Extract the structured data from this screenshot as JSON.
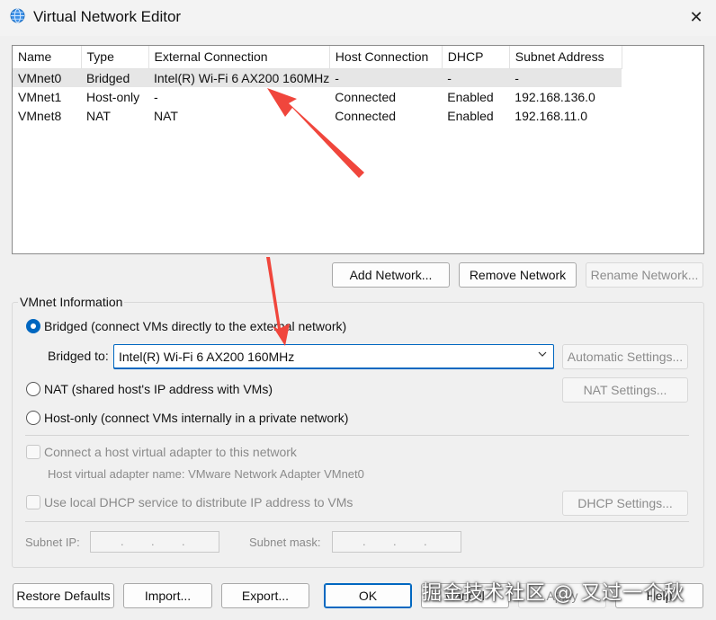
{
  "window": {
    "title": "Virtual Network Editor",
    "close_glyph": "✕",
    "icon": "globe-network-icon"
  },
  "network_table": {
    "columns": [
      "Name",
      "Type",
      "External Connection",
      "Host Connection",
      "DHCP",
      "Subnet Address"
    ],
    "rows": [
      [
        "VMnet0",
        "Bridged",
        "Intel(R) Wi-Fi 6 AX200 160MHz",
        "-",
        "-",
        "-"
      ],
      [
        "VMnet1",
        "Host-only",
        "-",
        "Connected",
        "Enabled",
        "192.168.136.0"
      ],
      [
        "VMnet8",
        "NAT",
        "NAT",
        "Connected",
        "Enabled",
        "192.168.11.0"
      ]
    ],
    "selected_row": 0
  },
  "table_buttons": {
    "add": "Add Network...",
    "remove": "Remove Network",
    "rename": "Rename Network..."
  },
  "vmnet_info": {
    "group_title": "VMnet Information",
    "bridged_label": "Bridged (connect VMs directly to the external network)",
    "bridged_to_label": "Bridged to:",
    "bridged_to_value": "Intel(R) Wi-Fi 6 AX200 160MHz",
    "automatic_settings": "Automatic Settings...",
    "nat_label": "NAT (shared host's IP address with VMs)",
    "nat_settings": "NAT Settings...",
    "hostonly_label": "Host-only (connect VMs internally in a private network)",
    "connect_adapter_label": "Connect a host virtual adapter to this network",
    "adapter_name_text": "Host virtual adapter name: VMware Network Adapter VMnet0",
    "dhcp_label": "Use local DHCP service to distribute IP address to VMs",
    "dhcp_settings": "DHCP Settings...",
    "subnet_ip_label": "Subnet IP:",
    "subnet_mask_label": "Subnet mask:",
    "selected_mode": "bridged"
  },
  "footer": {
    "restore": "Restore Defaults",
    "import": "Import...",
    "export": "Export...",
    "ok": "OK",
    "cancel": "Cancel",
    "apply": "Apply",
    "help": "Help"
  },
  "watermark": "掘金技术社区 @ 又过一个秋",
  "colors": {
    "accent": "#0067c0",
    "annotation_arrow": "#f0463c",
    "selected_row": "#e6e6e6"
  }
}
